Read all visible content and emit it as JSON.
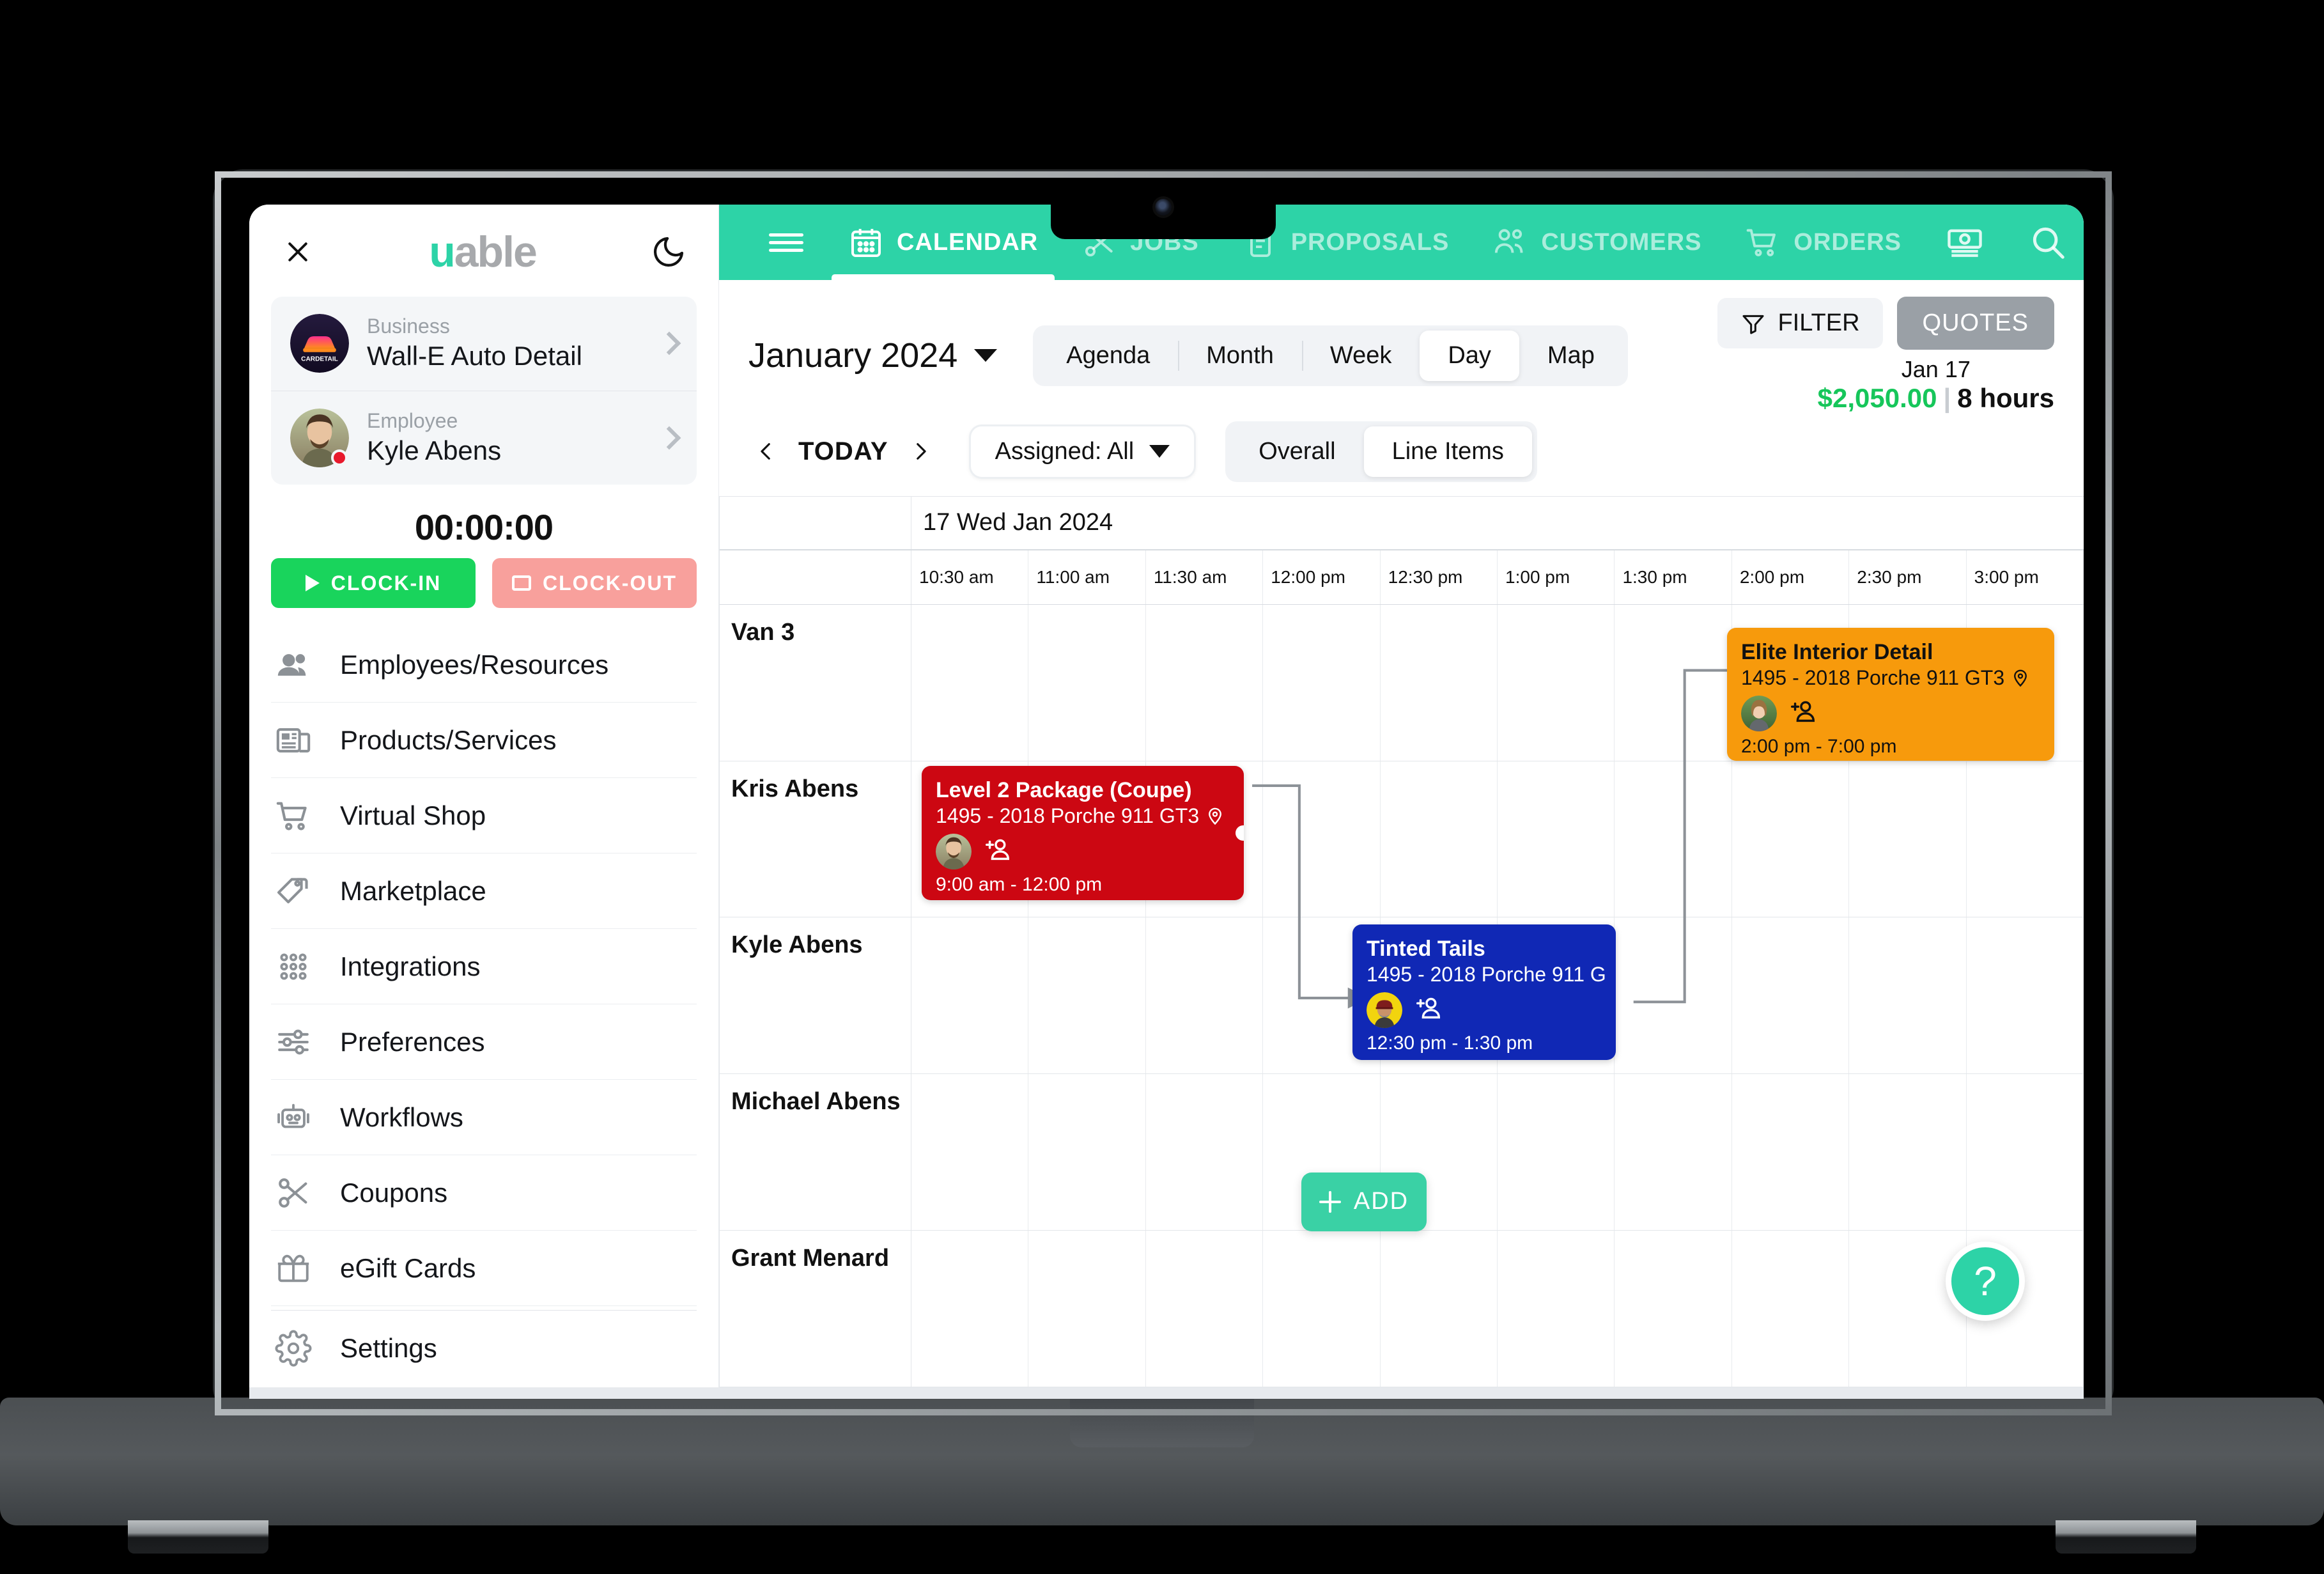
{
  "app": {
    "brand_u": "u",
    "brand_rest": "able",
    "close_label": "close",
    "theme_toggle": "dark-mode"
  },
  "sidebar": {
    "business": {
      "label": "Business",
      "value": "Wall-E Auto Detail",
      "logo_text": "CARDETAIL"
    },
    "employee": {
      "label": "Employee",
      "value": "Kyle Abens"
    },
    "timer": "00:00:00",
    "clock_in": "CLOCK-IN",
    "clock_out": "CLOCK-OUT",
    "items": [
      {
        "label": "Employees/Resources",
        "icon": "people-icon"
      },
      {
        "label": "Products/Services",
        "icon": "catalog-icon"
      },
      {
        "label": "Virtual Shop",
        "icon": "cart-icon"
      },
      {
        "label": "Marketplace",
        "icon": "tag-icon"
      },
      {
        "label": "Integrations",
        "icon": "grid-dots-icon"
      },
      {
        "label": "Preferences",
        "icon": "sliders-icon"
      },
      {
        "label": "Workflows",
        "icon": "robot-icon"
      },
      {
        "label": "Coupons",
        "icon": "scissors-icon"
      },
      {
        "label": "eGift Cards",
        "icon": "gift-icon"
      }
    ],
    "settings": {
      "label": "Settings",
      "icon": "gear-icon"
    }
  },
  "topnav": {
    "items": [
      {
        "label": "CALENDAR",
        "icon": "calendar-icon",
        "active": true
      },
      {
        "label": "JOBS",
        "icon": "scissors-icon",
        "active": false
      },
      {
        "label": "PROPOSALS",
        "icon": "document-icon",
        "active": false
      },
      {
        "label": "CUSTOMERS",
        "icon": "customers-icon",
        "active": false
      },
      {
        "label": "ORDERS",
        "icon": "cart-icon",
        "active": false
      }
    ],
    "icons": [
      "cash-icon",
      "search-icon",
      "bell-icon"
    ],
    "notification_badge": true,
    "accent_color": "#2DD3A7"
  },
  "toolbar": {
    "month": "January  2024",
    "views": [
      {
        "label": "Agenda",
        "active": false
      },
      {
        "label": "Month",
        "active": false
      },
      {
        "label": "Week",
        "active": false
      },
      {
        "label": "Day",
        "active": true
      },
      {
        "label": "Map",
        "active": false
      }
    ],
    "filter": "FILTER",
    "quotes": "QUOTES",
    "summary_date": "Jan 17",
    "summary_amount": "$2,050.00",
    "summary_divider": "|",
    "summary_hours": "8 hours",
    "amount_color": "#16c65a"
  },
  "toolbar2": {
    "today": "TODAY",
    "assigned": "Assigned: All",
    "modes": [
      {
        "label": "Overall",
        "active": false
      },
      {
        "label": "Line Items",
        "active": true
      }
    ]
  },
  "calendar": {
    "date_header": "17 Wed Jan 2024",
    "time_slots": [
      "10:30 am",
      "11:00 am",
      "11:30 am",
      "12:00 pm",
      "12:30 pm",
      "1:00 pm",
      "1:30 pm",
      "2:00 pm",
      "2:30 pm",
      "3:00 pm"
    ],
    "resources": [
      "Van 3",
      "Kris Abens",
      "Kyle Abens",
      "Michael Abens",
      "Grant Menard"
    ],
    "add_label": "ADD",
    "help_label": "?",
    "events": [
      {
        "title": "Elite Interior Detail",
        "subtitle": "1495 - 2018 Porche 911 GT3",
        "time": "2:00 pm - 7:00 pm",
        "color": "#f79a0c",
        "resource": "Kris Abens",
        "text_color": "#111111"
      },
      {
        "title": "Level 2 Package (Coupe)",
        "subtitle": "1495 - 2018 Porche 911 GT3",
        "time": "9:00 am - 12:00 pm",
        "color": "#cc0712",
        "resource": "Kyle Abens",
        "text_color": "#ffffff"
      },
      {
        "title": "Tinted Tails",
        "subtitle": "1495 - 2018 Porche 911 G",
        "time": "12:30 pm - 1:30 pm",
        "color": "#1028b5",
        "resource": "Michael Abens",
        "text_color": "#ffffff"
      }
    ]
  }
}
